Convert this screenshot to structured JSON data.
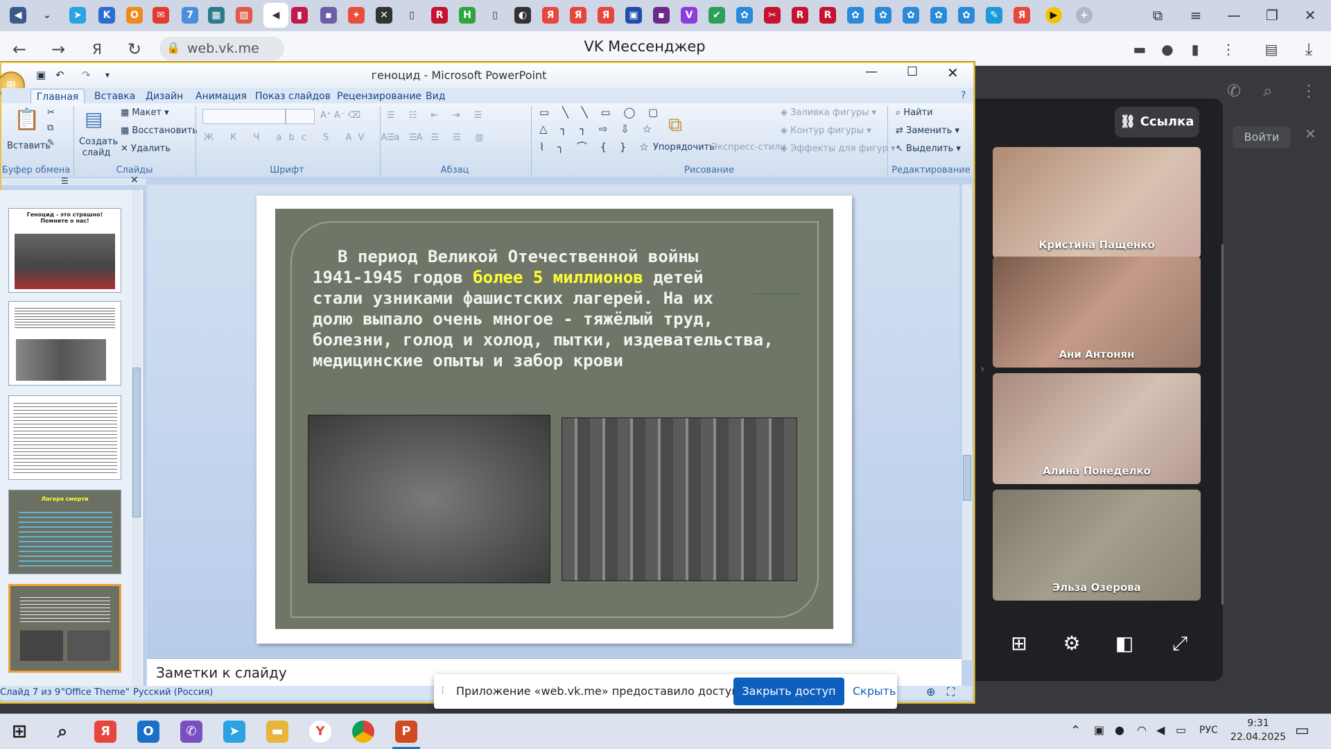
{
  "browser": {
    "address": "web.vk.me",
    "title": "VK Мессенджер"
  },
  "ppt": {
    "window_title": "геноцид - Microsoft PowerPoint",
    "tabs": [
      "Главная",
      "Вставка",
      "Дизайн",
      "Анимация",
      "Показ слайдов",
      "Рецензирование",
      "Вид"
    ],
    "groups": {
      "clipboard": {
        "label": "Буфер обмена",
        "paste": "Вставить"
      },
      "slides": {
        "label": "Слайды",
        "new_slide": "Создать слайд",
        "layout": "Макет",
        "reset": "Восстановить",
        "delete": "Удалить"
      },
      "font": {
        "label": "Шрифт"
      },
      "paragraph": {
        "label": "Абзац"
      },
      "drawing": {
        "label": "Рисование",
        "arrange": "Упорядочить",
        "quick_styles": "Экспресс-стили",
        "fill": "Заливка фигуры",
        "outline": "Контур фигуры",
        "effects": "Эффекты для фигур"
      },
      "editing": {
        "label": "Редактирование",
        "find": "Найти",
        "replace": "Заменить",
        "select": "Выделить"
      }
    },
    "thumbnails": {
      "t1_title": "Геноцид - это страшно! Помните о нас!",
      "t4_title": "Лагеря смерти"
    },
    "slide": {
      "line1": "В период Великой Отечественной войны",
      "line2_pre": "1941-1945 годов ",
      "line2_hl": "более 5 миллионов",
      "line2_post": " детей",
      "line3": "стали узниками фашистских лагерей. На их",
      "line4": "долю выпало очень многое - тяжёлый труд,",
      "line5": "болезни, голод и холод, пытки, издевательства,",
      "line6": "медицинские опыты и забор крови"
    },
    "notes_placeholder": "Заметки к слайду",
    "status": {
      "slide_counter": "Слайд 7 из 9",
      "theme": "\"Office Theme\"",
      "language": "Русский (Россия)"
    }
  },
  "vk": {
    "link_button": "Ссылка",
    "login": "Войти",
    "participants": [
      "Кристина Пащенко",
      "Ани Антонян",
      "Алина Понеделко",
      "Эльза Озерова"
    ]
  },
  "share_banner": {
    "text": "Приложение «web.vk.me» предоставило доступ к окну.",
    "stop": "Закрыть доступ",
    "hide": "Скрыть"
  },
  "taskbar": {
    "time": "9:31",
    "date": "22.04.2025",
    "lang": "РУС"
  },
  "colors": {
    "vk_blue": "#0f5fbf",
    "ppt_frame": "#e6c24a",
    "slide_bg": "#707667",
    "highlight": "#ffff33"
  }
}
